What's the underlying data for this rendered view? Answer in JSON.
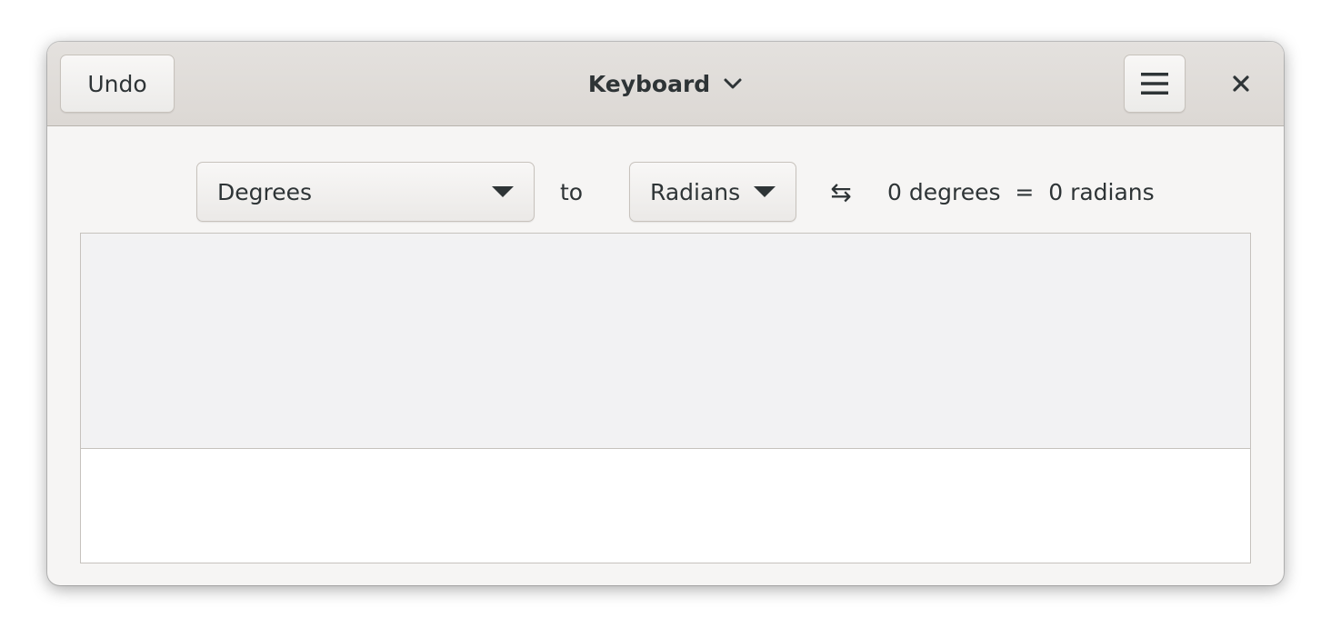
{
  "headerbar": {
    "undo_label": "Undo",
    "title": "Keyboard",
    "title_icon": "chevron-down-icon",
    "menu_icon": "hamburger-menu-icon",
    "close_icon": "close-icon"
  },
  "converter": {
    "from_unit": "Degrees",
    "to_label": "to",
    "to_unit": "Radians",
    "swap_icon": "swap-arrows-icon",
    "swap_glyph": "⇆",
    "result_text": "0 degrees  =  0 radians"
  },
  "display": {
    "entry_value": ""
  },
  "colors": {
    "text": "#2e3436",
    "window_bg": "#f6f5f4",
    "headerbar_bg": "#dedad6",
    "history_bg": "#f2f2f3",
    "entry_bg": "#ffffff"
  }
}
